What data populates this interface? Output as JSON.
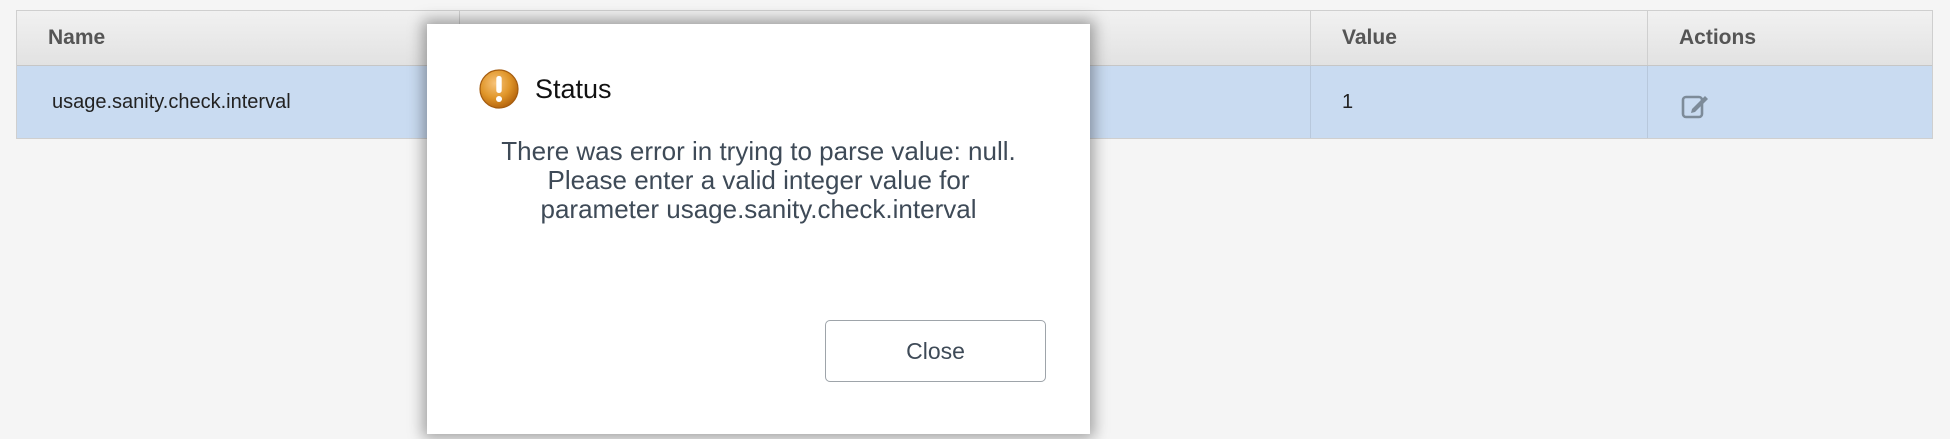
{
  "table": {
    "headers": {
      "name": "Name",
      "value": "Value",
      "actions": "Actions"
    },
    "rows": [
      {
        "name": "usage.sanity.check.interval",
        "value": "1",
        "action_icon": "edit-icon"
      }
    ]
  },
  "dialog": {
    "icon": "warning-icon",
    "title": "Status",
    "message_lines": [
      "There was error in trying to parse value: null.",
      "Please enter a valid integer value for",
      "parameter usage.sanity.check.interval"
    ],
    "close_label": "Close"
  },
  "colors": {
    "selected_row": "#c9dbf1",
    "header_bg": "#e2e2e2",
    "warning_orange": "#e0962a",
    "message_text": "#3e4a57"
  }
}
